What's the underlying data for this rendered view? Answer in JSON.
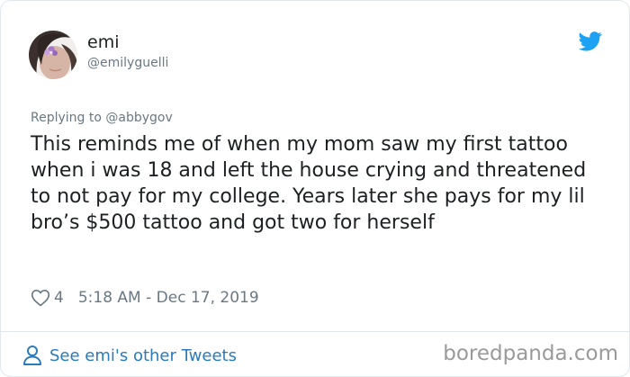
{
  "author": {
    "name": "emi",
    "handle": "@emilyguelli"
  },
  "tweet": {
    "replying_to": "Replying to @abbygov",
    "text": "This reminds me of when my mom saw my first tattoo when i was 18 and left the house crying and threatened to not pay for my college. Years later she pays for my lil bro’s $500 tattoo and got two for herself",
    "likes": "4",
    "timestamp": "5:18 AM - Dec 17, 2019"
  },
  "footer": {
    "see_more_label": "See emi's other Tweets"
  },
  "watermark": "boredpanda.com",
  "icons": {
    "bird": "twitter-bird-icon",
    "heart": "heart-outline-icon",
    "person": "person-outline-icon"
  },
  "colors": {
    "twitter_blue": "#1da1f2",
    "link_blue": "#2b7bb9",
    "muted_text": "#697882"
  }
}
